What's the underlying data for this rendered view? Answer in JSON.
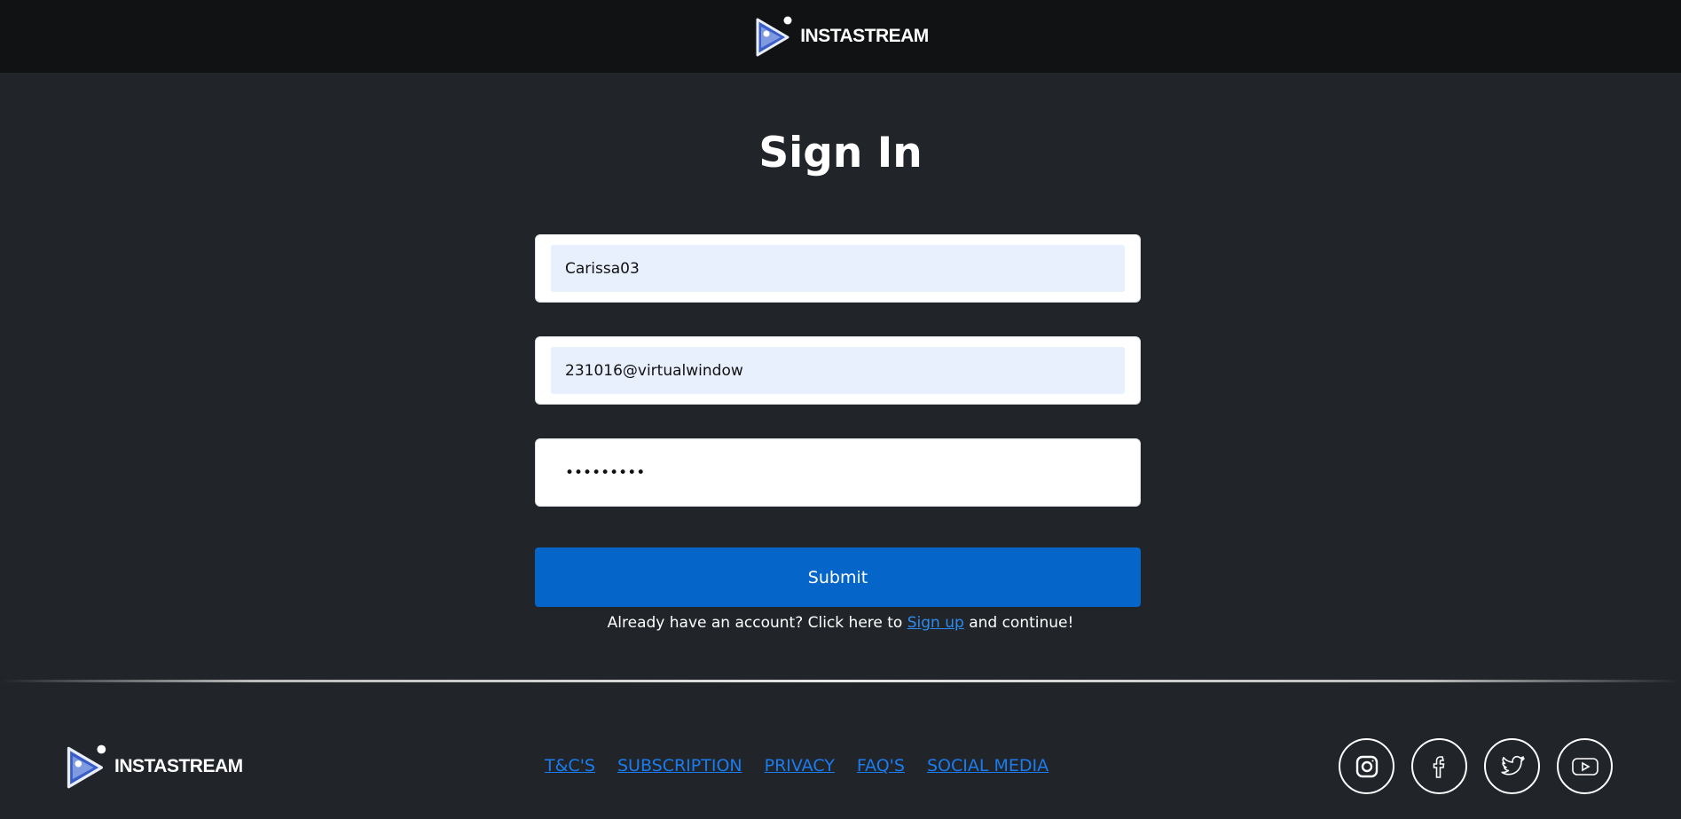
{
  "header": {
    "brand_name": "INSTASTREAM"
  },
  "title": "Sign In",
  "form": {
    "username_value": "Carissa03",
    "email_value": "231016@virtualwindow",
    "password_value": "•••••••••",
    "submit_label": "Submit"
  },
  "signup": {
    "prefix": "Already have an account? Click here to ",
    "link": "Sign up",
    "suffix": " and continue!"
  },
  "footer": {
    "brand_name": "INSTASTREAM",
    "links": [
      "T&C'S",
      "SUBSCRIPTION",
      "PRIVACY",
      "FAQ'S",
      "SOCIAL MEDIA"
    ],
    "socials": [
      "instagram-icon",
      "facebook-icon",
      "twitter-icon",
      "youtube-icon"
    ]
  },
  "colors": {
    "background": "#212429",
    "topbar": "#111213",
    "accent": "#0665c9",
    "link": "#1a7cf0",
    "input_autofill": "#e8f0fe"
  }
}
